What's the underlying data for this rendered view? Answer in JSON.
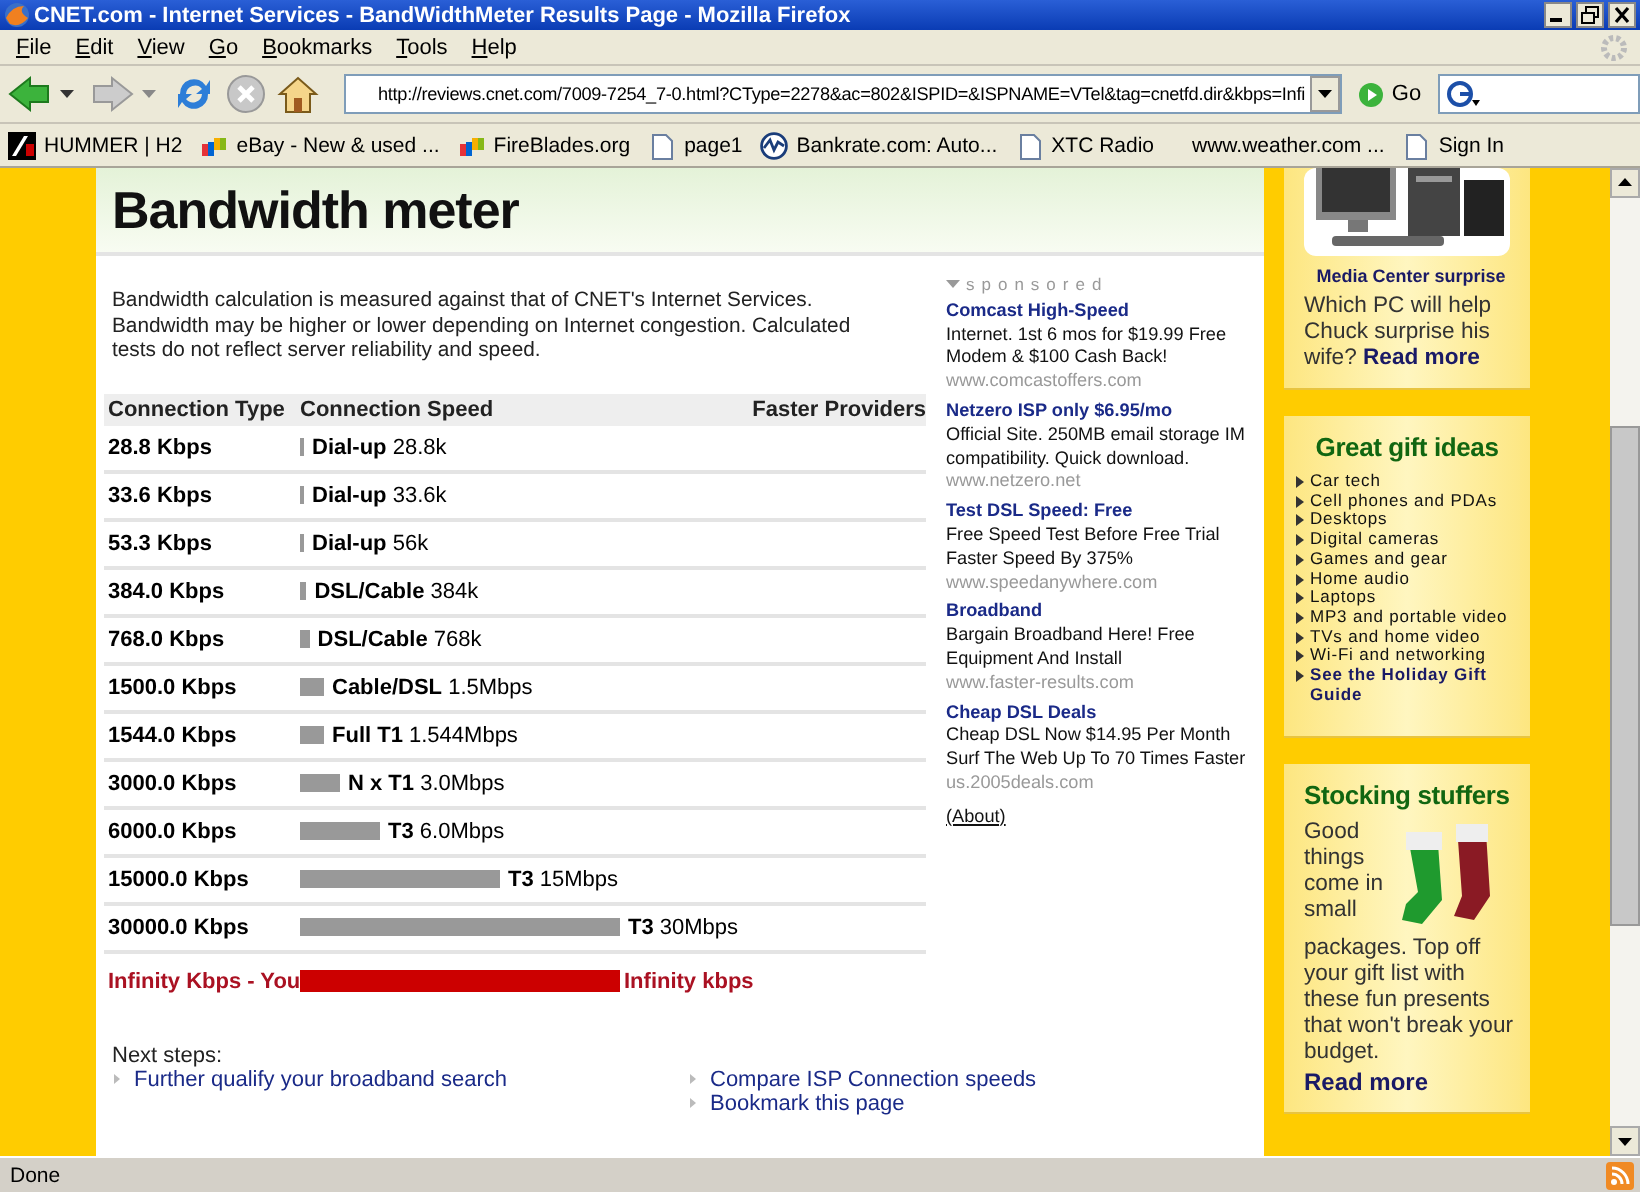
{
  "window": {
    "title": "CNET.com - Internet Services - BandWidthMeter Results Page - Mozilla Firefox"
  },
  "menu": [
    "File",
    "Edit",
    "View",
    "Go",
    "Bookmarks",
    "Tools",
    "Help"
  ],
  "toolbar": {
    "address": "http://reviews.cnet.com/7009-7254_7-0.html?CType=2278&ac=802&ISPID=&ISPNAME=VTel&tag=cnetfd.dir&kbps=Infi",
    "go": "Go"
  },
  "bookmarks": [
    {
      "label": "HUMMER | H2",
      "kind": "logo"
    },
    {
      "label": "eBay - New & used ...",
      "kind": "ebay"
    },
    {
      "label": "FireBlades.org",
      "kind": "ebay"
    },
    {
      "label": "page1",
      "kind": "page"
    },
    {
      "label": "Bankrate.com: Auto...",
      "kind": "wave"
    },
    {
      "label": "XTC Radio",
      "kind": "page"
    },
    {
      "label": "www.weather.com ...",
      "kind": "none"
    },
    {
      "label": "Sign In",
      "kind": "page"
    }
  ],
  "page": {
    "heading": "Bandwidth meter",
    "intro": "Bandwidth calculation is measured against that of CNET's Internet Services. Bandwidth may be higher or lower depending on Internet congestion. Calculated tests do not reflect server reliability and speed.",
    "table": {
      "columns": [
        "Connection Type",
        "Connection Speed",
        "Faster Providers"
      ],
      "rows": [
        {
          "type": "28.8 Kbps",
          "speed": "**Dial-up** 28.8k",
          "level": 0.0125,
          "highlight": false
        },
        {
          "type": "33.6 Kbps",
          "speed": "**Dial-up** 33.6k",
          "level": 0.0125,
          "highlight": false
        },
        {
          "type": "53.3 Kbps",
          "speed": "**Dial-up** 56k",
          "level": 0.0125,
          "highlight": false
        },
        {
          "type": "384.0 Kbps",
          "speed": "**DSL/Cable** 384k",
          "level": 0.02,
          "highlight": false
        },
        {
          "type": "768.0 Kbps",
          "speed": "**DSL/Cable** 768k",
          "level": 0.03,
          "highlight": false
        },
        {
          "type": "1500.0 Kbps",
          "speed": "**Cable/DSL** 1.5Mbps",
          "level": 0.075,
          "highlight": false
        },
        {
          "type": "1544.0 Kbps",
          "speed": "**Full T1** 1.544Mbps",
          "level": 0.075,
          "highlight": false
        },
        {
          "type": "3000.0 Kbps",
          "speed": "**N x T1** 3.0Mbps",
          "level": 0.125,
          "highlight": false
        },
        {
          "type": "6000.0 Kbps",
          "speed": "**T3** 6.0Mbps",
          "level": 0.25,
          "highlight": false
        },
        {
          "type": "15000.0 Kbps",
          "speed": "**T3** 15Mbps",
          "level": 0.625,
          "highlight": false
        },
        {
          "type": "30000.0 Kbps",
          "speed": "**T3** 30Mbps",
          "level": 1.0,
          "highlight": false
        },
        {
          "type": "Infinity Kbps - You",
          "speed": "Infinity kbps",
          "level": 1.0,
          "highlight": true
        }
      ]
    },
    "ads": {
      "label": "sponsored",
      "items": [
        {
          "title": "Comcast High-Speed",
          "text": "Internet. 1st 6 mos for $19.99 Free Modem & $100 Cash Back!",
          "url": "www.comcastoffers.com"
        },
        {
          "title": "Netzero ISP only $6.95/mo",
          "text": "Official Site. 250MB email storage IM compatibility. Quick download.",
          "url": "www.netzero.net"
        },
        {
          "title": "Test DSL Speed: Free",
          "text": "Free Speed Test Before Free Trial Faster Speed By 375%",
          "url": "www.speedanywhere.com"
        },
        {
          "title": "Broadband",
          "text": "Bargain Broadband Here! Free Equipment And Install",
          "url": "www.faster-results.com"
        },
        {
          "title": "Cheap DSL Deals",
          "text": "Cheap DSL Now $14.95 Per Month Surf The Web Up To 70 Times Faster",
          "url": "us.2005deals.com"
        }
      ],
      "about": "(About)"
    },
    "next_steps": {
      "label": "Next steps:",
      "column_1": [
        "Further qualify your broadband search"
      ],
      "column_2": [
        "Compare ISP Connection speeds",
        "Bookmark this page"
      ]
    }
  },
  "sidebar": {
    "promo": {
      "caption": "Media Center surprise",
      "text": "Which PC will help Chuck surprise his wife?",
      "link": "Read more"
    },
    "gifts": {
      "title": "Great gift ideas",
      "items": [
        {
          "label": "Car tech",
          "featured": false
        },
        {
          "label": "Cell phones and PDAs",
          "featured": false
        },
        {
          "label": "Desktops",
          "featured": false
        },
        {
          "label": "Digital cameras",
          "featured": false
        },
        {
          "label": "Games and gear",
          "featured": false
        },
        {
          "label": "Home audio",
          "featured": false
        },
        {
          "label": "Laptops",
          "featured": false
        },
        {
          "label": "MP3 and portable video",
          "featured": false
        },
        {
          "label": "TVs and home video",
          "featured": false
        },
        {
          "label": "Wi-Fi and networking",
          "featured": false
        },
        {
          "label": "See the Holiday Gift Guide",
          "featured": true
        }
      ]
    },
    "stocking": {
      "title": "Stocking stuffers",
      "text": "Good things come in small packages. Top off your gift list with these fun presents that won't break your budget.",
      "link": "Read more"
    }
  },
  "status_bar": "Done"
}
